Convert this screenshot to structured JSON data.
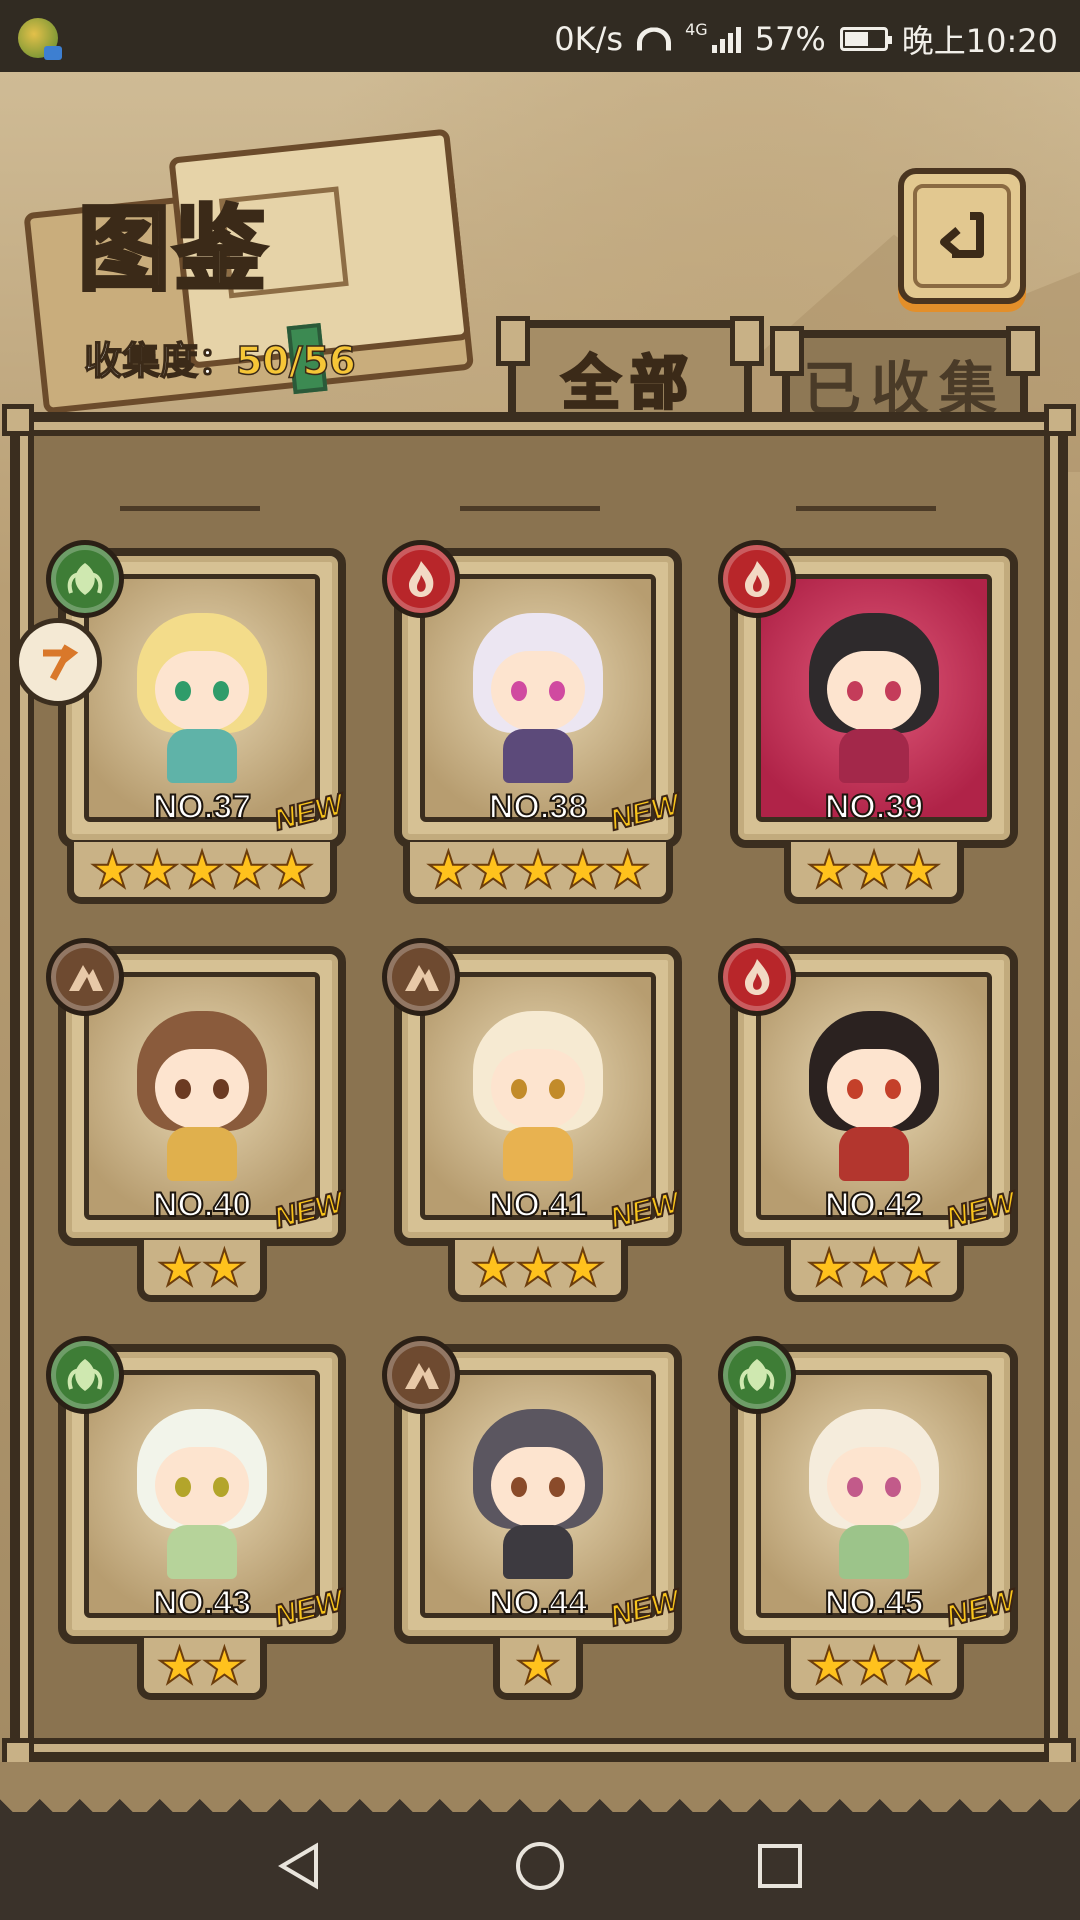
{
  "status_bar": {
    "net_speed": "0K/s",
    "network": "4G",
    "battery": "57%",
    "time": "晚上10:20"
  },
  "header": {
    "title": "图鉴",
    "collection_label": "收集度：",
    "collection_value": "50/56"
  },
  "tabs": [
    {
      "label": "全部",
      "active": true
    },
    {
      "label": "已收集",
      "active": false
    }
  ],
  "cards": [
    {
      "no": "NO.37",
      "stars": "★★★★★",
      "element": "leaf",
      "new": "NEW",
      "hair": "#f3dc8a",
      "eye": "#2f9c6a",
      "body": "#5fb3a8"
    },
    {
      "no": "NO.38",
      "stars": "★★★★★",
      "element": "fire",
      "new": "NEW",
      "hair": "#ece6f2",
      "eye": "#d04aa0",
      "body": "#5c4a7a"
    },
    {
      "no": "NO.39",
      "stars": "★★★",
      "element": "fire",
      "new": "",
      "hair": "#2e2a2c",
      "eye": "#c43c5a",
      "body": "#a3284a"
    },
    {
      "no": "NO.40",
      "stars": "★★",
      "element": "earth",
      "new": "NEW",
      "hair": "#8a5b3c",
      "eye": "#6b3a22",
      "body": "#e0b04d"
    },
    {
      "no": "NO.41",
      "stars": "★★★",
      "element": "earth",
      "new": "NEW",
      "hair": "#f6ead2",
      "eye": "#c28b2a",
      "body": "#e8b250"
    },
    {
      "no": "NO.42",
      "stars": "★★★",
      "element": "fire",
      "new": "NEW",
      "hair": "#2b2220",
      "eye": "#c4402a",
      "body": "#b3362e"
    },
    {
      "no": "NO.43",
      "stars": "★★",
      "element": "leaf",
      "new": "NEW",
      "hair": "#f2f4ea",
      "eye": "#b3a52a",
      "body": "#b6d39a"
    },
    {
      "no": "NO.44",
      "stars": "★",
      "element": "earth",
      "new": "NEW",
      "hair": "#5b5660",
      "eye": "#8a4b2a",
      "body": "#3d3a40"
    },
    {
      "no": "NO.45",
      "stars": "★★★",
      "element": "leaf",
      "new": "NEW",
      "hair": "#f5ecdc",
      "eye": "#c25a8a",
      "body": "#9cc48a"
    }
  ],
  "colors": {
    "accent_orange": "#e38f2a",
    "star_gold": "#ffc21d",
    "collection_gold": "#f6c637"
  },
  "icons": {
    "back": "back-arrow-icon",
    "leaf": "leaf-element-icon",
    "fire": "fire-element-icon",
    "earth": "earth-element-icon",
    "side": "bookmark-arrow-icon"
  },
  "nav_bar": {
    "back": "back-triangle-icon",
    "home": "home-circle-icon",
    "recents": "recents-square-icon"
  }
}
